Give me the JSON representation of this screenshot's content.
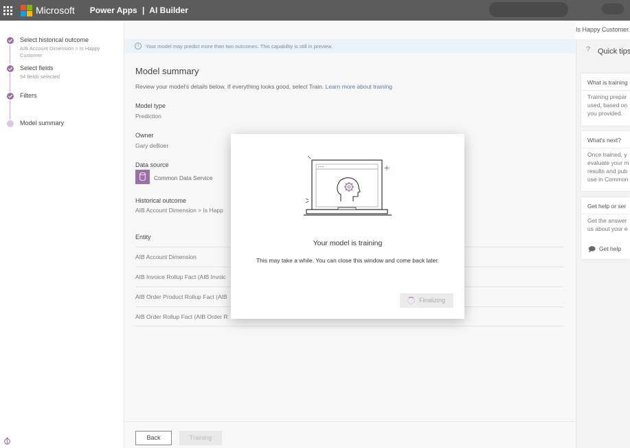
{
  "topbar": {
    "brand": "Microsoft",
    "app": "Power Apps",
    "separator": "|",
    "section": "AI Builder",
    "bg_color": "#5c5c5c"
  },
  "stepper": {
    "steps": [
      {
        "title": "Select historical outcome",
        "subtitle": "AIB Account Dimension > Is Happy Customer",
        "state": "done"
      },
      {
        "title": "Select fields",
        "subtitle": "54 fields selected",
        "state": "done"
      },
      {
        "title": "Filters",
        "subtitle": "",
        "state": "done"
      },
      {
        "title": "Model summary",
        "subtitle": "",
        "state": "current"
      }
    ],
    "accent": "#9d6fa7"
  },
  "header_right": "Is Happy Customer.",
  "infobar": {
    "text": "Your model may predict more than two outcomes. This capability is still in preview."
  },
  "summary": {
    "title": "Model summary",
    "description": "Review your model's details below. If everything looks good, select Train.",
    "learn_more": "Learn more about training",
    "model_type_label": "Model type",
    "model_type_value": "Prediction",
    "owner_label": "Owner",
    "owner_value": "Gary deBoer",
    "data_source_label": "Data source",
    "data_source_value": "Common Data Service",
    "historical_label": "Historical outcome",
    "historical_value": "AIB Account Dimension > Is Happ",
    "entity_label": "Entity",
    "entities": [
      "AIB Account Dimension",
      "AIB Invoice Rollup Fact (AIB Invoic",
      "AIB Order Product Rollup Fact (AIB",
      "AIB Order Rollup Fact (AIB Order R"
    ]
  },
  "footer": {
    "back_label": "Back",
    "training_label": "Training"
  },
  "tips": {
    "title": "Quick tips",
    "cards": [
      {
        "heading": "What is training",
        "body": [
          "Training prepar",
          "used, based on",
          "you provided."
        ]
      },
      {
        "heading": "What's next?",
        "body": [
          "Once trained, y",
          "evaluate your m",
          "results and pub",
          "use in Common"
        ]
      },
      {
        "heading": "Get help or ser",
        "body": [
          "Get the answer",
          "us about your e"
        ]
      }
    ],
    "get_help": "Get help"
  },
  "modal": {
    "title": "Your model is training",
    "subtitle": "This may take a while. You can close this window and come back later.",
    "status_label": "Finalizing"
  }
}
